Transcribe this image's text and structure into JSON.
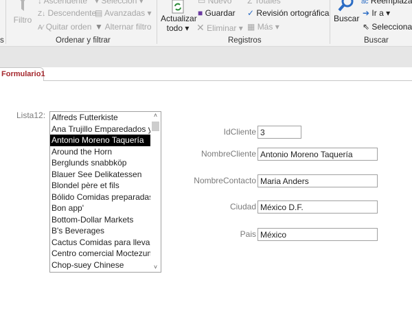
{
  "ribbon": {
    "filter_group": {
      "label": "Ordenar y filtrar",
      "filtro": "Filtro",
      "ascendente": "Ascendente",
      "descendente": "Descendente",
      "quitar_orden": "Quitar orden",
      "seleccion": "Selección",
      "avanzadas": "Avanzadas",
      "alternar_filtro": "Alternar filtro"
    },
    "records_group": {
      "label": "Registros",
      "actualizar_1": "Actualizar",
      "actualizar_2": "todo",
      "nuevo": "Nuevo",
      "guardar": "Guardar",
      "eliminar": "Eliminar",
      "totales": "Totales",
      "revision": "Revisión ortográfica",
      "mas": "Más"
    },
    "find_group": {
      "label": "Buscar",
      "buscar": "Buscar",
      "reemplazar": "Reemplazar",
      "ir_a": "Ir a",
      "seleccionar": "Seleccionar"
    }
  },
  "tab": {
    "label": "Formulario1"
  },
  "form": {
    "list_label": "Lista12:",
    "list_items": [
      "Alfreds Futterkiste",
      "Ana Trujillo Emparedados y helados",
      "Antonio Moreno Taquería",
      "Around the Horn",
      "Berglunds snabbköp",
      "Blauer See Delikatessen",
      "Blondel père et fils",
      "Bólido Comidas preparadas",
      "Bon app'",
      "Bottom-Dollar Markets",
      "B's Beverages",
      "Cactus Comidas para llevar",
      "Centro comercial Moctezuma",
      "Chop-suey Chinese"
    ],
    "selected_index": 2,
    "fields": [
      {
        "label": "IdCliente",
        "value": "3"
      },
      {
        "label": "NombreCliente",
        "value": "Antonio Moreno Taquería"
      },
      {
        "label": "NombreContacto",
        "value": "Maria Anders"
      },
      {
        "label": "Ciudad",
        "value": "México D.F."
      },
      {
        "label": "Pais",
        "value": "México"
      }
    ]
  }
}
